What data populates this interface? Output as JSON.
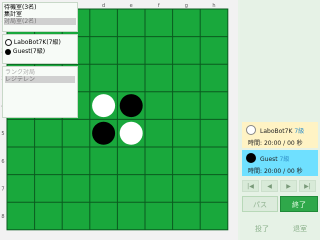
{
  "board": {
    "columns": [
      "a",
      "b",
      "c",
      "d",
      "e",
      "f",
      "g",
      "h"
    ],
    "rows": [
      "1",
      "2",
      "3",
      "4",
      "5",
      "6",
      "7",
      "8"
    ],
    "stones": [
      {
        "cell": "d4",
        "color": "white"
      },
      {
        "cell": "e4",
        "color": "black"
      },
      {
        "cell": "d5",
        "color": "black"
      },
      {
        "cell": "e5",
        "color": "white"
      }
    ],
    "colors": {
      "felt": "#19a83c",
      "grid": "#0a5a1f",
      "frame": "#f2f2f2"
    }
  },
  "rooms": {
    "items": [
      "待機室(3名)",
      "集計室",
      "対局室(2名)"
    ],
    "selected_index": 2
  },
  "players_list": {
    "items": [
      "LaboBot7K(7級)",
      "Guest(7級)"
    ]
  },
  "rank_panel": {
    "items": [
      "ランク対局",
      "レジテレン"
    ]
  },
  "cards": {
    "white": {
      "name": "LaboBot7K",
      "rank": "7級",
      "time_label": "時間:",
      "time": "20:00 / 00 秒",
      "color": "#fff3c4"
    },
    "black": {
      "name": "Guest",
      "rank": "7級",
      "time_label": "時間:",
      "time": "20:00 / 00 秒",
      "color": "#6fe0ff"
    }
  },
  "nav": {
    "first": "|◀",
    "prev": "◀",
    "next": "▶",
    "last": "▶|"
  },
  "buttons": {
    "pass": "パス",
    "end": "終了"
  },
  "bottom": {
    "left": "投了",
    "right": "退室"
  }
}
